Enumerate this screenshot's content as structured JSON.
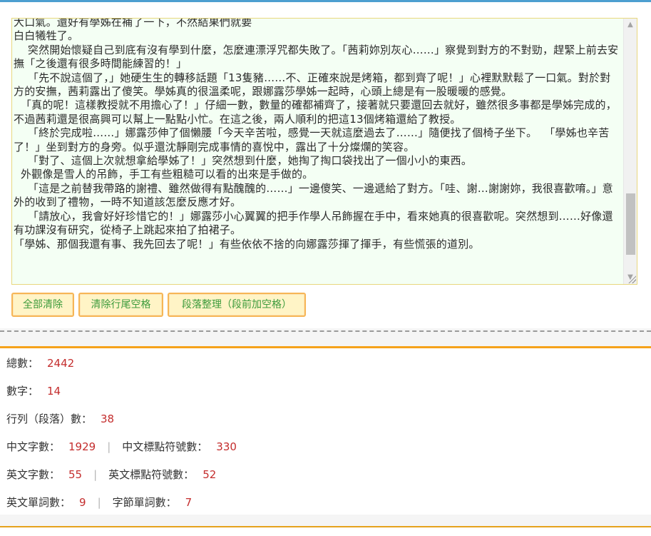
{
  "editor": {
    "text": "大口氣。還好有學姊在補了一下，不然結果們就要\n白白犧牲了。\n    突然開始懷疑自己到底有沒有學到什麼，怎麼連漂浮咒都失敗了。「茜莉妳別灰心……」察覺到對方的不對勁，趕緊上前去安撫「之後還有很多時間能練習的！」\n    「先不說這個了，」她硬生生的轉移話題「13隻豬……不、正確來說是烤箱，都到齊了呢！」心裡默默鬆了一口氣。對於對方的安撫，茜莉露出了傻笑。學姊真的很溫柔呢，跟娜露莎學姊一起時，心頭上總是有一股暖暖的感覺。\n  「真的呢！這樣教授就不用擔心了！」仔細一數，數量的確都補齊了，接著就只要還回去就好，雖然很多事都是學姊完成的，不過茜莉還是很高興可以幫上一點點小忙。在這之後，兩人順利的把這13個烤箱還給了教授。\n    「終於完成啦……」娜露莎伸了個懶腰「今天辛苦啦，感覺一天就這麼過去了……」隨便找了個椅子坐下。  「學姊也辛苦了！」坐到對方的身旁。似乎還沈靜剛完成事情的喜悅中，露出了十分燦爛的笑容。\n    「對了、這個上次就想拿給學姊了！」突然想到什麼，她掏了掏口袋找出了一個小小的東西。\n  外觀像是雪人的吊飾，手工有些粗糙可以看的出來是手做的。\n    「這是之前替我帶路的謝禮、雖然做得有點醜醜的……」一邊傻笑、一邊遞給了對方。「哇、謝…謝謝妳，我很喜歡唷。」意外的收到了禮物，一時不知道該怎麼反應才好。\n    「請放心，我會好好珍惜它的！」娜露莎小心翼翼的把手作學人吊飾握在手中，看來她真的很喜歡呢。突然想到……好像還有功課沒有研究，從椅子上跳起來拍了拍裙子。\n「學姊、那個我還有事、我先回去了呢！」有些依依不捨的向娜露莎揮了揮手，有些慌張的道別。"
  },
  "buttons": {
    "clear_all": "全部清除",
    "trim_trailing": "清除行尾空格",
    "paragraph_format": "段落整理（段前加空格）"
  },
  "stats": {
    "total_label": "總數：",
    "total_value": "2442",
    "digits_label": "數字：",
    "digits_value": "14",
    "lines_label": "行列（段落）數：",
    "lines_value": "38",
    "cn_chars_label": "中文字數：",
    "cn_chars_value": "1929",
    "cn_punct_label": "中文標點符號數：",
    "cn_punct_value": "330",
    "en_chars_label": "英文字數：",
    "en_chars_value": "55",
    "en_punct_label": "英文標點符號數：",
    "en_punct_value": "52",
    "en_words_label": "英文單詞數：",
    "en_words_value": "9",
    "syllable_words_label": "字節單詞數：",
    "syllable_words_value": "7",
    "separator": "|"
  },
  "colors": {
    "accent_top": "#4d9fd0",
    "stats_border": "#f5a21b",
    "button_border": "#f6b656",
    "button_bg": "#fff4c6",
    "button_text": "#3c9b3c",
    "value_red": "#c42d2d",
    "textarea_bg": "#f4fff4"
  }
}
